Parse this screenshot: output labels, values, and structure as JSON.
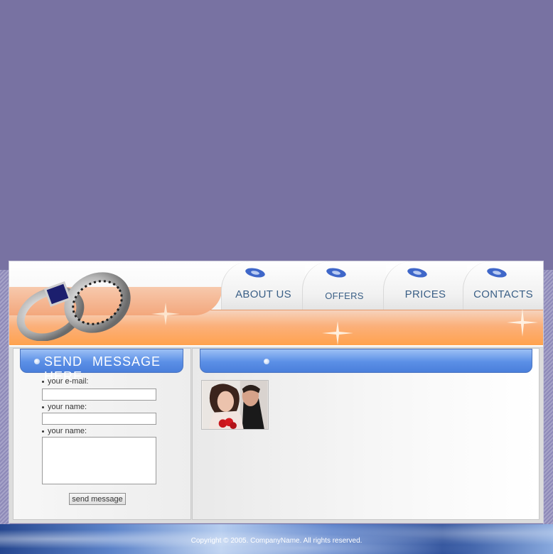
{
  "nav": {
    "items": [
      {
        "label": "ABOUT US"
      },
      {
        "label": "OFFERS"
      },
      {
        "label": "PRICES"
      },
      {
        "label": "CONTACTS"
      }
    ]
  },
  "left_panel": {
    "title": "SEND MESSAGE HERE",
    "email_label": "your e-mail:",
    "name_label": "your name:",
    "message_label": "your name:",
    "email_value": "",
    "name_value": "",
    "message_value": "",
    "submit_label": "send message"
  },
  "right_panel": {
    "title": ""
  },
  "footer": {
    "copyright": "Copyright © 2005. CompanyName. All rights reserved."
  },
  "colors": {
    "page_background": "#7872a2",
    "nav_text": "#3a5f86",
    "header_orange": "#ffa24e",
    "title_bar_blue": "#5b8fe6"
  },
  "icons": [
    "rings-logo",
    "disc-icon",
    "bullet-icon",
    "sparkle-icon"
  ]
}
